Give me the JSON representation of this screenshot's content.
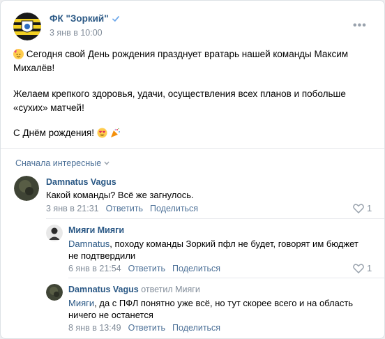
{
  "post": {
    "author": "ФК \"Зоркий\"",
    "date": "3 янв в 10:00",
    "line1": "Сегодня свой День рождения празднует вратарь нашей команды Максим",
    "line2": "Михалёв!",
    "line3": "Желаем крепкого здоровья, удачи, осуществления всех планов и побольше",
    "line4": "«сухих» матчей!",
    "line5": "С Днём рождения!",
    "more_icon": "more-dots-icon"
  },
  "comments_sort": "Сначала интересные",
  "comments": [
    {
      "author": "Damnatus Vagus",
      "text": "Какой команды? Всё же загнулось.",
      "date": "3 янв в 21:31",
      "reply": "Ответить",
      "share": "Поделиться",
      "likes": "1"
    },
    {
      "author": "Мияги Мияги",
      "mention": "Damnatus",
      "text_line1": ", походу команды Зоркий пфл не будет, говорят им бюджет",
      "text_line2": "не подтвердили",
      "date": "6 янв в 21:54",
      "reply": "Ответить",
      "share": "Поделиться",
      "likes": "1"
    },
    {
      "author": "Damnatus Vagus",
      "reply_to": "ответил Мияги",
      "mention": "Мияги",
      "text_line1": ", да с ПФЛ понятно уже всё, но тут скорее всего и на область",
      "text_line2": "ничего не останется",
      "date": "8 янв в 13:49",
      "reply": "Ответить",
      "share": "Поделиться"
    }
  ],
  "colors": {
    "link": "#2a5885",
    "muted": "#818c99",
    "action": "#4d7198"
  }
}
